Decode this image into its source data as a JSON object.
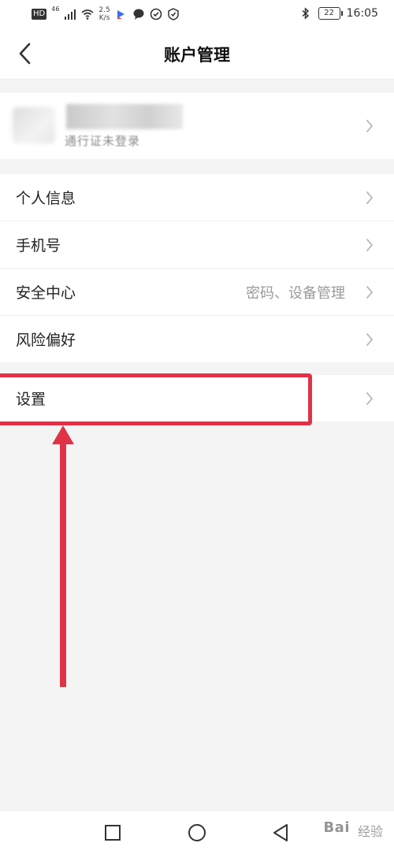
{
  "status_bar": {
    "network_hd": "HD",
    "network_type": "46",
    "speed_value": "2.5",
    "speed_unit": "K/s",
    "battery": "22",
    "time": "16:05"
  },
  "nav": {
    "title": "账户管理"
  },
  "profile": {
    "subtitle": "通行证未登录"
  },
  "menu_group_1": [
    {
      "label": "个人信息",
      "value": ""
    },
    {
      "label": "手机号",
      "value": ""
    },
    {
      "label": "安全中心",
      "value": "密码、设备管理"
    },
    {
      "label": "风险偏好",
      "value": ""
    }
  ],
  "menu_group_2": [
    {
      "label": "设置",
      "value": ""
    }
  ],
  "annotation": {
    "color": "#e03347"
  },
  "watermark": {
    "brand": "Bai",
    "suffix": "经验"
  },
  "icons": {
    "back": "chevron-left-icon",
    "chevron": "chevron-right-icon",
    "recent": "square-icon",
    "home": "circle-icon",
    "back_nav": "triangle-back-icon"
  }
}
